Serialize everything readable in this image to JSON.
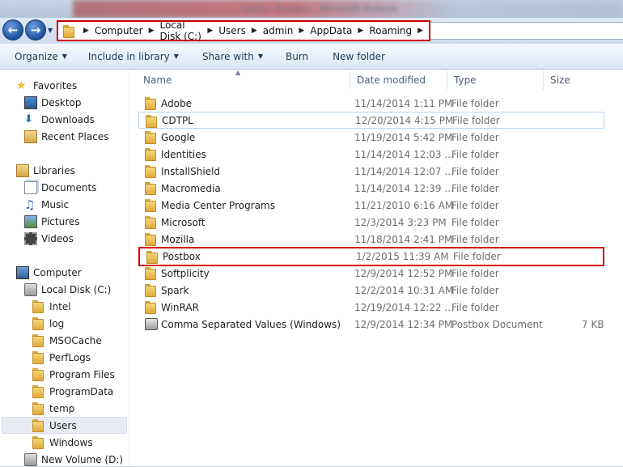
{
  "window": {
    "title": "Inbox - Postbox - Microsoft Outlook"
  },
  "navigation": {
    "breadcrumb": [
      "Computer",
      "Local Disk (C:)",
      "Users",
      "admin",
      "AppData",
      "Roaming"
    ]
  },
  "toolbar": {
    "organize": "Organize",
    "include_in_library": "Include in library",
    "share_with": "Share with",
    "burn": "Burn",
    "new_folder": "New folder"
  },
  "sidebar": {
    "favorites": "Favorites",
    "desktop": "Desktop",
    "downloads": "Downloads",
    "recent_places": "Recent Places",
    "libraries": "Libraries",
    "documents": "Documents",
    "music": "Music",
    "pictures": "Pictures",
    "videos": "Videos",
    "computer": "Computer",
    "local_disk": "Local Disk (C:)",
    "folders": [
      "Intel",
      "log",
      "MSOCache",
      "PerfLogs",
      "Program Files",
      "ProgramData",
      "temp",
      "Users",
      "Windows"
    ],
    "new_volume": "New Volume (D:)"
  },
  "columns": {
    "name": "Name",
    "date_modified": "Date modified",
    "type": "Type",
    "size": "Size"
  },
  "files": [
    {
      "name": "Adobe",
      "date": "11/14/2014 1:11 PM",
      "type": "File folder",
      "size": ""
    },
    {
      "name": "CDTPL",
      "date": "12/20/2014 4:15 PM",
      "type": "File folder",
      "size": ""
    },
    {
      "name": "Google",
      "date": "11/19/2014 5:42 PM",
      "type": "File folder",
      "size": ""
    },
    {
      "name": "Identities",
      "date": "11/14/2014 12:03 ...",
      "type": "File folder",
      "size": ""
    },
    {
      "name": "InstallShield",
      "date": "11/14/2014 12:07 ...",
      "type": "File folder",
      "size": ""
    },
    {
      "name": "Macromedia",
      "date": "11/14/2014 12:39 ...",
      "type": "File folder",
      "size": ""
    },
    {
      "name": "Media Center Programs",
      "date": "11/21/2010 6:16 AM",
      "type": "File folder",
      "size": ""
    },
    {
      "name": "Microsoft",
      "date": "12/3/2014 3:23 PM",
      "type": "File folder",
      "size": ""
    },
    {
      "name": "Mozilla",
      "date": "11/18/2014 2:41 PM",
      "type": "File folder",
      "size": ""
    },
    {
      "name": "Postbox",
      "date": "1/2/2015 11:39 AM",
      "type": "File folder",
      "size": ""
    },
    {
      "name": "Softplicity",
      "date": "12/9/2014 12:52 PM",
      "type": "File folder",
      "size": ""
    },
    {
      "name": "Spark",
      "date": "12/2/2014 10:31 AM",
      "type": "File folder",
      "size": ""
    },
    {
      "name": "WinRAR",
      "date": "12/19/2014 12:22 ...",
      "type": "File folder",
      "size": ""
    },
    {
      "name": "Comma Separated Values (Windows)",
      "date": "12/9/2014 12:34 PM",
      "type": "Postbox Document",
      "size": "7 KB"
    }
  ]
}
